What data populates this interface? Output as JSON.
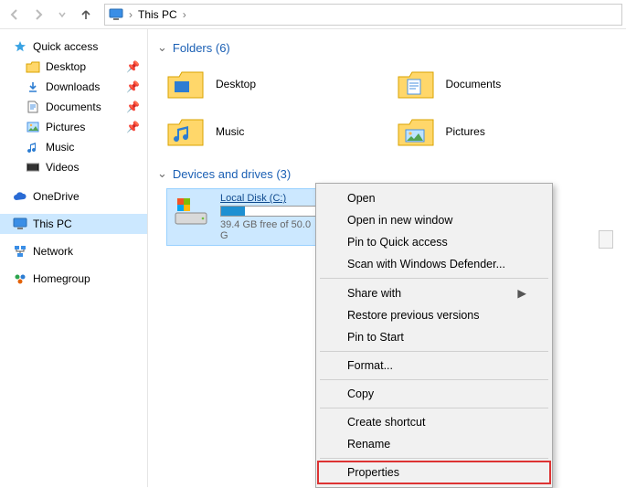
{
  "address": {
    "root": "This PC"
  },
  "sidebar": {
    "quick_access": "Quick access",
    "items": [
      {
        "label": "Desktop",
        "pin": true
      },
      {
        "label": "Downloads",
        "pin": true
      },
      {
        "label": "Documents",
        "pin": true
      },
      {
        "label": "Pictures",
        "pin": true
      },
      {
        "label": "Music",
        "pin": false
      },
      {
        "label": "Videos",
        "pin": false
      }
    ],
    "onedrive": "OneDrive",
    "thispc": "This PC",
    "network": "Network",
    "homegroup": "Homegroup"
  },
  "sections": {
    "folders_header": "Folders (6)",
    "drives_header": "Devices and drives (3)"
  },
  "folders": [
    {
      "label": "Desktop"
    },
    {
      "label": "Documents"
    },
    {
      "label": "Music"
    },
    {
      "label": "Pictures"
    }
  ],
  "drive": {
    "title": "Local Disk (C:)",
    "detail": "39.4 GB free of 50.0 G"
  },
  "context_menu": {
    "groups": [
      [
        "Open",
        "Open in new window",
        "Pin to Quick access",
        "Scan with Windows Defender..."
      ],
      [
        "Share with",
        "Restore previous versions",
        "Pin to Start"
      ],
      [
        "Format..."
      ],
      [
        "Copy"
      ],
      [
        "Create shortcut",
        "Rename"
      ],
      [
        "Properties"
      ]
    ],
    "submenu_hint": "Share with",
    "highlighted": "Properties"
  }
}
